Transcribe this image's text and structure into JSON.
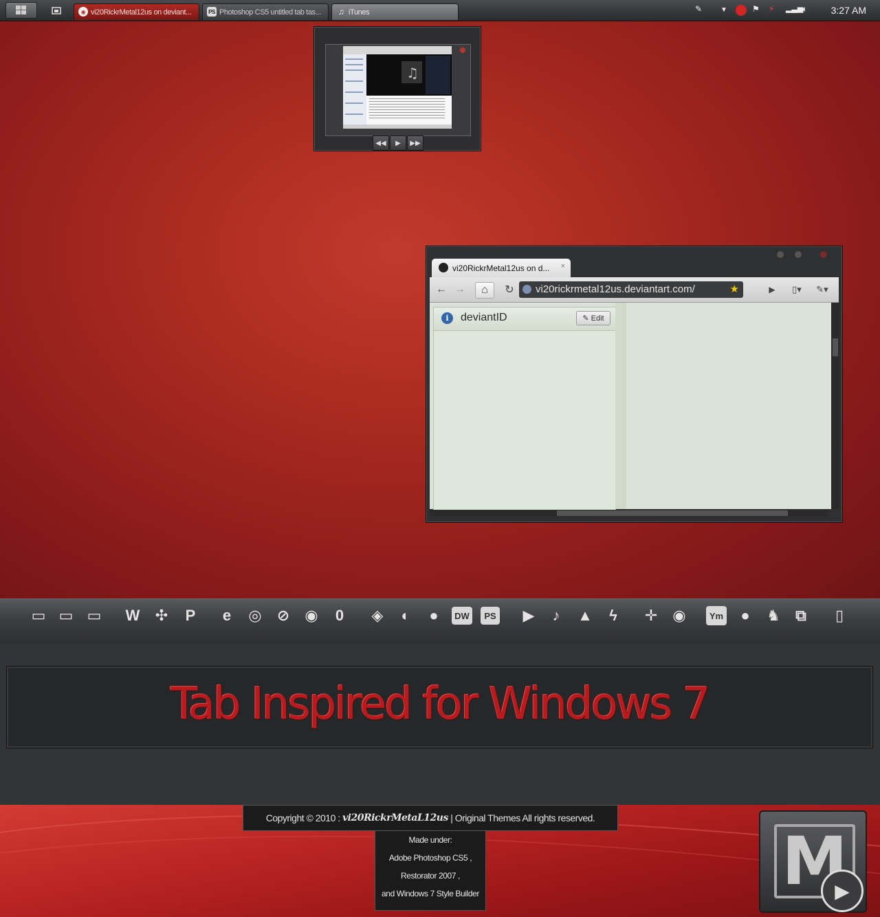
{
  "taskbar": {
    "tabs": [
      {
        "label": "vi20RickrMetal12us on deviant...",
        "icon": "chrome-icon"
      },
      {
        "label": "Photoshop  CS5 untitled tab tas...",
        "icon": "ps-icon",
        "icon_text": "PS"
      },
      {
        "label": "iTunes",
        "icon": "music-note-icon",
        "icon_text": "♫"
      }
    ],
    "clock": "3:27 AM"
  },
  "thumbnail": {
    "controls": [
      "◀◀",
      "▶",
      "▶▶"
    ]
  },
  "browser": {
    "tab_title": "vi20RickrMetal12us on d...",
    "tab_close": "×",
    "url": "vi20rickrmetal12us.deviantart.com/",
    "panel_title": "deviantID",
    "info_glyph": "i",
    "edit_label": "Edit"
  },
  "dock": {
    "items": [
      "▭",
      "▭",
      "▭",
      "W",
      "✣",
      "P",
      "e",
      "◎",
      "⊘",
      "◉",
      "0",
      "◈",
      "◐",
      "●",
      "DW",
      "PS",
      "▶",
      "♪",
      "▲",
      "ϟ",
      "✛",
      "◉",
      "Ym",
      "●",
      "♞",
      "⧉",
      "▯"
    ]
  },
  "banner": {
    "title": "Tab Inspired for Windows 7"
  },
  "footer": {
    "copyright_prefix": "Copyright © 2010 :",
    "copyright_author": "vi20RickrMetaL12us",
    "copyright_suffix": "| Original Themes  All rights reserved.",
    "made_lines": [
      "Made under:",
      "Adobe Photoshop CS5 ,",
      "Restorator 2007 ,",
      "and Windows 7  Style Builder"
    ],
    "logo_letter": "M",
    "logo_play": "▶"
  },
  "colors": {
    "accent_red": "#b71b1e",
    "desktop_red": "#a92a20",
    "dark_panel": "#262729"
  }
}
